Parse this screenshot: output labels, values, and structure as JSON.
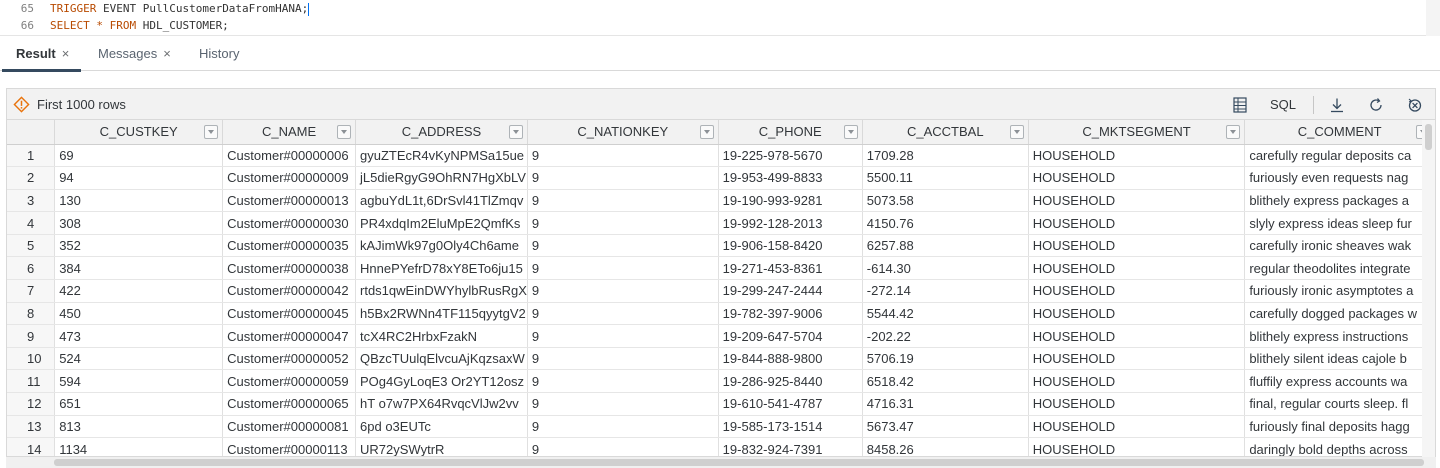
{
  "editor": {
    "lines": [
      {
        "number": "65",
        "keyword": "TRIGGER",
        "rest": " EVENT PullCustomerDataFromHANA;"
      },
      {
        "number": "66",
        "keyword": "SELECT * FROM",
        "rest": " HDL_CUSTOMER;"
      }
    ]
  },
  "tabs": [
    {
      "label": "Result",
      "close": "×"
    },
    {
      "label": "Messages",
      "close": "×"
    },
    {
      "label": "History"
    }
  ],
  "toolbar": {
    "label": "First 1000 rows",
    "sql_label": "SQL",
    "icons": [
      "warning-icon",
      "column-settings-icon",
      "download-icon",
      "refresh-icon",
      "clear-icon"
    ]
  },
  "grid": {
    "columns": [
      "C_CUSTKEY",
      "C_NAME",
      "C_ADDRESS",
      "C_NATIONKEY",
      "C_PHONE",
      "C_ACCTBAL",
      "C_MKTSEGMENT",
      "C_COMMENT"
    ],
    "rows": [
      {
        "n": "1",
        "cells": [
          "69",
          "Customer#00000006",
          "gyuZTEcR4vKyNPMSa15ue",
          "9",
          "19-225-978-5670",
          "1709.28",
          "HOUSEHOLD",
          "carefully regular deposits ca"
        ]
      },
      {
        "n": "2",
        "cells": [
          "94",
          "Customer#00000009",
          "jL5dieRgyG9OhRN7HgXbLV",
          "9",
          "19-953-499-8833",
          "5500.11",
          "HOUSEHOLD",
          "furiously even requests nag"
        ]
      },
      {
        "n": "3",
        "cells": [
          "130",
          "Customer#00000013",
          "agbuYdL1t,6DrSvl41TlZmqv",
          "9",
          "19-190-993-9281",
          "5073.58",
          "HOUSEHOLD",
          "blithely express packages a"
        ]
      },
      {
        "n": "4",
        "cells": [
          "308",
          "Customer#00000030",
          "PR4xdqIm2EluMpE2QmfKs",
          "9",
          "19-992-128-2013",
          "4150.76",
          "HOUSEHOLD",
          "slyly express ideas sleep fur"
        ]
      },
      {
        "n": "5",
        "cells": [
          "352",
          "Customer#00000035",
          "kAJimWk97g0Oly4Ch6ame",
          "9",
          "19-906-158-8420",
          "6257.88",
          "HOUSEHOLD",
          "carefully ironic sheaves wak"
        ]
      },
      {
        "n": "6",
        "cells": [
          "384",
          "Customer#00000038",
          "HnnePYefrD78xY8ETo6ju15",
          "9",
          "19-271-453-8361",
          "-614.30",
          "HOUSEHOLD",
          "regular theodolites integrate"
        ]
      },
      {
        "n": "7",
        "cells": [
          "422",
          "Customer#00000042",
          "rtds1qwEinDWYhylbRusRgX",
          "9",
          "19-299-247-2444",
          "-272.14",
          "HOUSEHOLD",
          "furiously ironic asymptotes a"
        ]
      },
      {
        "n": "8",
        "cells": [
          "450",
          "Customer#00000045",
          "h5Bx2RWNn4TF115qyytgV2",
          "9",
          "19-782-397-9006",
          "5544.42",
          "HOUSEHOLD",
          "carefully dogged packages w"
        ]
      },
      {
        "n": "9",
        "cells": [
          "473",
          "Customer#00000047",
          "tcX4RC2HrbxFzakN",
          "9",
          "19-209-647-5704",
          "-202.22",
          "HOUSEHOLD",
          "blithely express instructions"
        ]
      },
      {
        "n": "10",
        "cells": [
          "524",
          "Customer#00000052",
          "QBzcTUulqElvcuAjKqzsaxW",
          "9",
          "19-844-888-9800",
          "5706.19",
          "HOUSEHOLD",
          "blithely silent ideas cajole b"
        ]
      },
      {
        "n": "11",
        "cells": [
          "594",
          "Customer#00000059",
          "POg4GyLoqE3 Or2YT12osz",
          "9",
          "19-286-925-8440",
          "6518.42",
          "HOUSEHOLD",
          "fluffily express accounts wa"
        ]
      },
      {
        "n": "12",
        "cells": [
          "651",
          "Customer#00000065",
          "hT o7w7PX64RvqcVlJw2vv",
          "9",
          "19-610-541-4787",
          "4716.31",
          "HOUSEHOLD",
          "final, regular courts sleep. fl"
        ]
      },
      {
        "n": "13",
        "cells": [
          "813",
          "Customer#00000081",
          "6pd o3EUTc",
          "9",
          "19-585-173-1514",
          "5673.47",
          "HOUSEHOLD",
          "furiously final deposits hagg"
        ]
      },
      {
        "n": "14",
        "cells": [
          "1134",
          "Customer#00000113",
          "UR72ySWytrR",
          "9",
          "19-832-924-7391",
          "8458.26",
          "HOUSEHOLD",
          "daringly bold depths across"
        ]
      }
    ]
  }
}
